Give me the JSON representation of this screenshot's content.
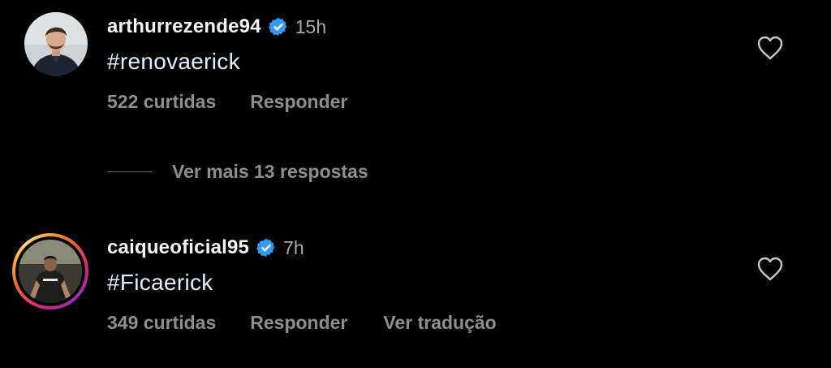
{
  "comments": [
    {
      "username": "arthurrezende94",
      "time": "15h",
      "text": "#renovaerick",
      "likes": "522 curtidas",
      "reply": "Responder",
      "has_story_ring": false
    },
    {
      "username": "caiqueoficial95",
      "time": "7h",
      "text": "#Ficaerick",
      "likes": "349 curtidas",
      "reply": "Responder",
      "translate": "Ver tradução",
      "has_story_ring": true
    }
  ],
  "replies_toggle": {
    "label": "Ver mais 13 respostas"
  },
  "colors": {
    "background": "#000000",
    "username": "#f5f5f5",
    "comment_text": "#e0f1ff",
    "secondary": "#8e8e8e",
    "verified_badge": "#3897f0"
  },
  "icons": {
    "verified": "verified-badge-icon",
    "like": "heart-outline-icon"
  }
}
